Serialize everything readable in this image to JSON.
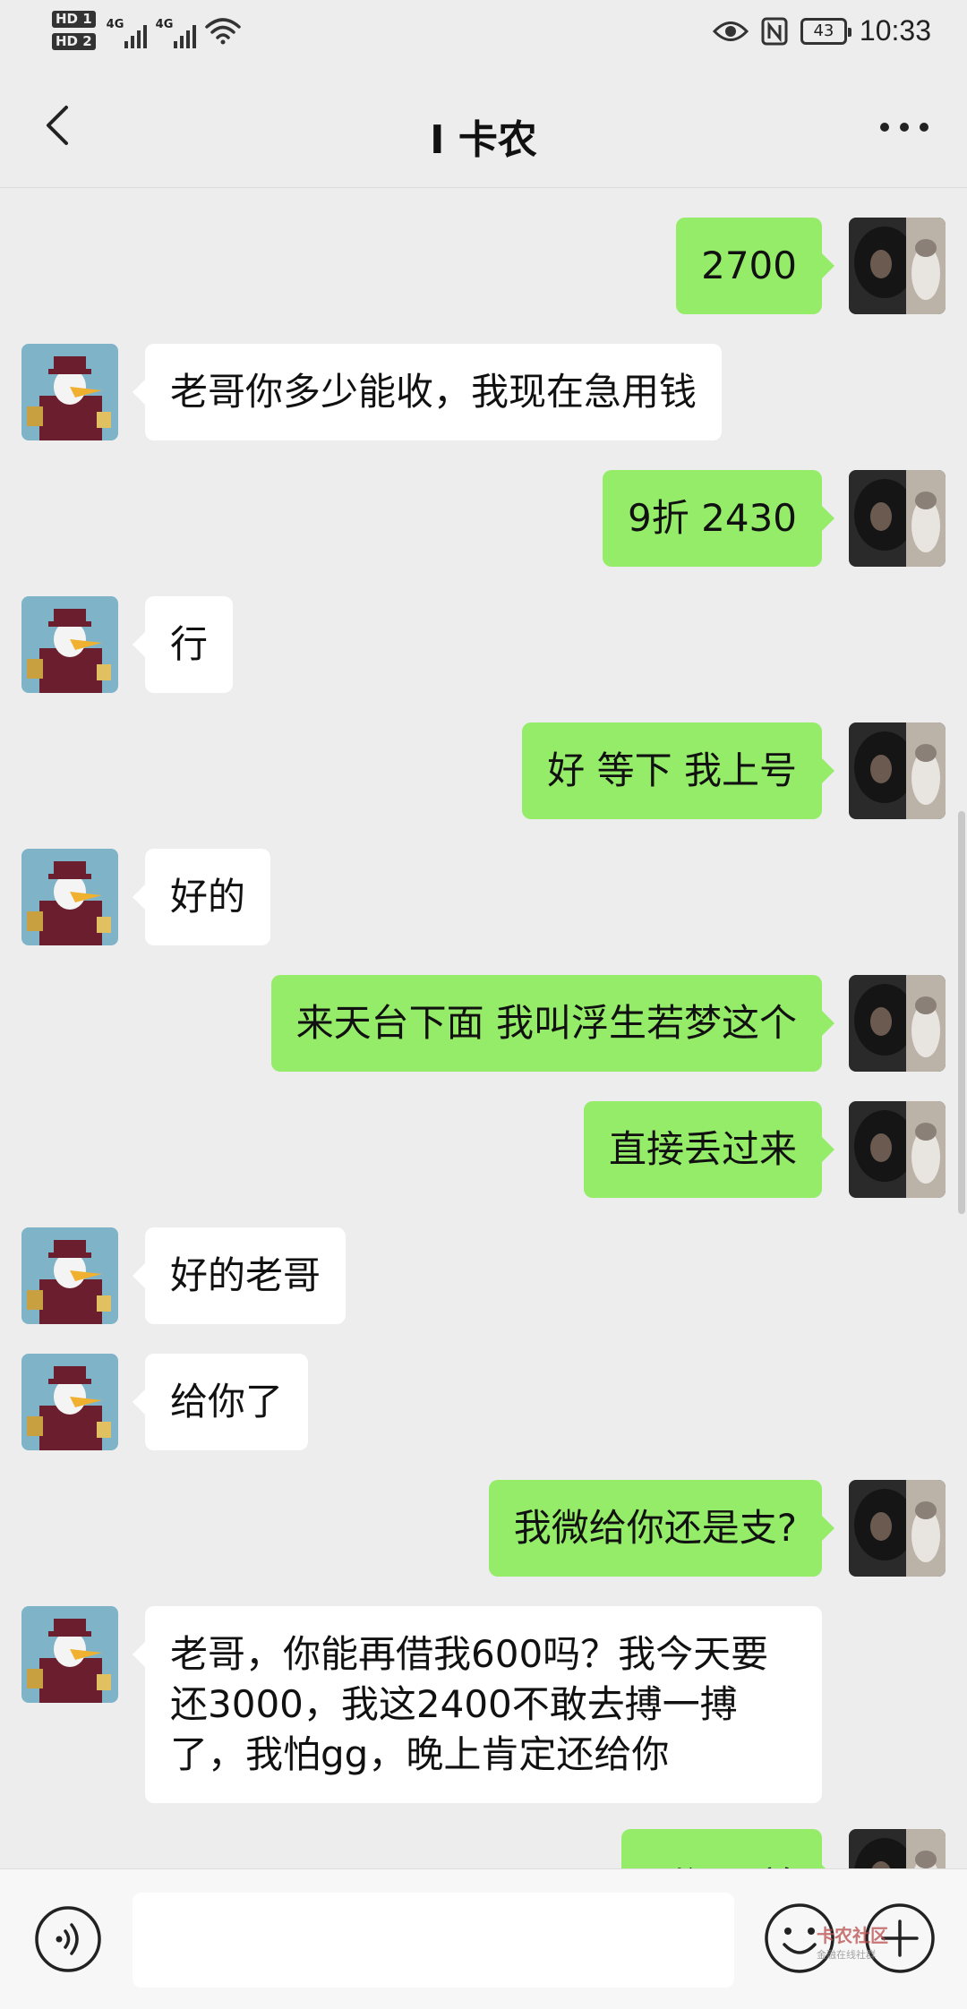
{
  "status_bar": {
    "hd1": "HD 1",
    "hd2": "HD 2",
    "net1": "4G",
    "net2": "4G",
    "battery": "43",
    "time": "10:33"
  },
  "nav": {
    "title": "I 卡农"
  },
  "messages": [
    {
      "side": "right",
      "text": "2700"
    },
    {
      "side": "left",
      "text": "老哥你多少能收，我现在急用钱"
    },
    {
      "side": "right",
      "text": "9折  2430"
    },
    {
      "side": "left",
      "text": "行"
    },
    {
      "side": "right",
      "text": "好 等下 我上号"
    },
    {
      "side": "left",
      "text": "好的"
    },
    {
      "side": "right",
      "text": "来天台下面  我叫浮生若梦这个"
    },
    {
      "side": "right",
      "text": "直接丢过来"
    },
    {
      "side": "left",
      "text": "好的老哥"
    },
    {
      "side": "left",
      "text": "给你了"
    },
    {
      "side": "right",
      "text": "我微给你还是支?"
    },
    {
      "side": "left",
      "text": "老哥，你能再借我600吗？我今天要还3000，我这2400不敢去搏一搏了，我怕gg，晚上肯定还给你"
    },
    {
      "side": "right",
      "text": "别闹兄弟"
    }
  ],
  "watermark": {
    "text": "卡农社区",
    "sub": "金融在线社群"
  },
  "colors": {
    "background": "#ededed",
    "sent_bubble": "#95ec69",
    "received_bubble": "#ffffff"
  }
}
